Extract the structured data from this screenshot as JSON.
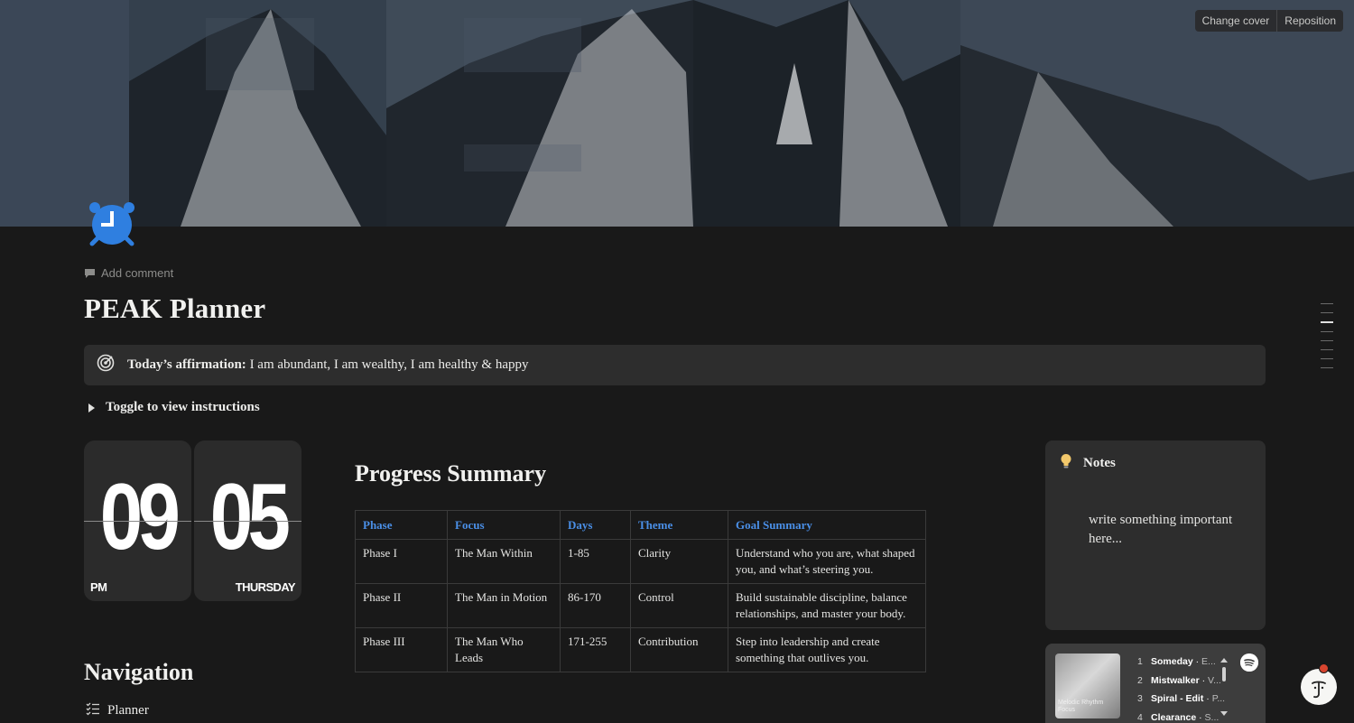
{
  "cover": {
    "change_cover_label": "Change cover",
    "reposition_label": "Reposition"
  },
  "page": {
    "icon": "alarm-clock-icon",
    "add_comment_label": "Add comment",
    "title": "PEAK Planner"
  },
  "affirmation": {
    "icon": "target-icon",
    "label": "Today’s affirmation:",
    "text": "I am abundant, I am wealthy, I am healthy & happy"
  },
  "toggle": {
    "label": "Toggle to view instructions"
  },
  "clock": {
    "hour": "09",
    "minute": "05",
    "meridiem": "PM",
    "weekday": "THURSDAY"
  },
  "progress": {
    "heading": "Progress Summary",
    "columns": [
      "Phase",
      "Focus",
      "Days",
      "Theme",
      "Goal Summary"
    ],
    "rows": [
      [
        "Phase I",
        "The Man Within",
        "1-85",
        "Clarity",
        "Understand who you are, what shaped you, and what’s steering you."
      ],
      [
        "Phase II",
        "The Man in Motion",
        "86-170",
        "Control",
        "Build sustainable discipline, balance relationships, and master your body."
      ],
      [
        "Phase III",
        "The Man Who Leads",
        "171-255",
        "Contribution",
        "Step into leadership and create something that outlives you."
      ]
    ]
  },
  "navigation": {
    "heading": "Navigation",
    "items": [
      {
        "icon": "checklist-icon",
        "label": "Planner"
      }
    ]
  },
  "notes": {
    "icon": "lightbulb-icon",
    "title": "Notes",
    "body": "write something important here..."
  },
  "spotify": {
    "art_caption": "Melodic Rhythm Focus",
    "tracks": [
      {
        "n": "1",
        "title": "Someday",
        "artist": "E..."
      },
      {
        "n": "2",
        "title": "Mistwalker",
        "artist": "V..."
      },
      {
        "n": "3",
        "title": "Spiral - Edit",
        "artist": "P..."
      },
      {
        "n": "4",
        "title": "Clearance",
        "artist": "S..."
      }
    ]
  },
  "colors": {
    "background": "#191919",
    "accent_blue": "#4a8fe7",
    "callout_bg": "#2d2d2d",
    "icon_blue": "#2f7fe0"
  }
}
